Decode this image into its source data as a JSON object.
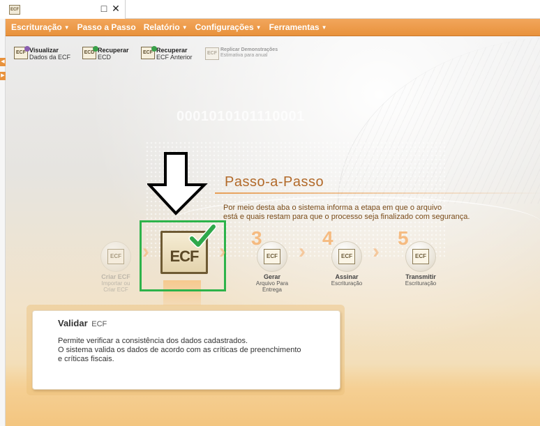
{
  "window": {
    "tab_icon_text": "ECF",
    "restore_glyph": "□",
    "close_glyph": "✕"
  },
  "menu": {
    "items": [
      {
        "label": "Escrituração",
        "dropdown": true
      },
      {
        "label": "Passo a Passo",
        "dropdown": false
      },
      {
        "label": "Relatório",
        "dropdown": true
      },
      {
        "label": "Configurações",
        "dropdown": true
      },
      {
        "label": "Ferramentas",
        "dropdown": true
      }
    ]
  },
  "toolbar": {
    "buttons": [
      {
        "line1": "Visualizar",
        "line2": "Dados da ECF",
        "icon": "ECF",
        "enabled": true
      },
      {
        "line1": "Recuperar",
        "line2": "ECD",
        "icon": "ECD",
        "enabled": true
      },
      {
        "line1": "Recuperar",
        "line2": "ECF Anterior",
        "icon": "ECF",
        "enabled": true
      },
      {
        "line1": "Replicar Demonstrações",
        "line2": "Estimativa para anual",
        "icon": "ECF",
        "enabled": false
      }
    ]
  },
  "background": {
    "binary_text": "0001010101110001"
  },
  "passo": {
    "title": "Passo-a-Passo",
    "desc_line1": "Por meio desta aba o sistema informa a etapa em que o arquivo",
    "desc_line2": "está e quais restam para que o processo seja finalizado com segurança."
  },
  "steps": [
    {
      "number": "",
      "label": "Criar ECF",
      "sub": [
        "Importar ou",
        "Criar ECF"
      ],
      "icon": "ECF",
      "state": "done"
    },
    {
      "number": "",
      "label": "",
      "sub": [],
      "icon": "ECF",
      "state": "current"
    },
    {
      "number": "3",
      "label": "Gerar",
      "sub": [
        "Arquivo Para",
        "Entrega"
      ],
      "icon": "ECF",
      "state": "pending"
    },
    {
      "number": "4",
      "label": "Assinar",
      "sub": [
        "Escrituração"
      ],
      "icon": "ECF",
      "state": "pending"
    },
    {
      "number": "5",
      "label": "Transmitir",
      "sub": [
        "Escrituração"
      ],
      "icon": "ECF",
      "state": "pending"
    }
  ],
  "current_step": {
    "icon_text": "ECF"
  },
  "panel": {
    "title": "Validar",
    "title_suffix": "ECF",
    "text_line1": "Permite verificar a consistência dos dados cadastrados.",
    "text_line2": "O sistema valida os dados de acordo com as críticas de preenchimento",
    "text_line3": "e críticas fiscais."
  },
  "colors": {
    "menu_orange": "#e8923c",
    "highlight_green": "#2db34a",
    "check_green": "#2fa84a",
    "title_brown": "#b26a2a"
  },
  "icons": {
    "restore": "restore-window-icon",
    "close": "close-icon",
    "check": "checkmark-icon",
    "down_arrow": "down-arrow-icon"
  }
}
